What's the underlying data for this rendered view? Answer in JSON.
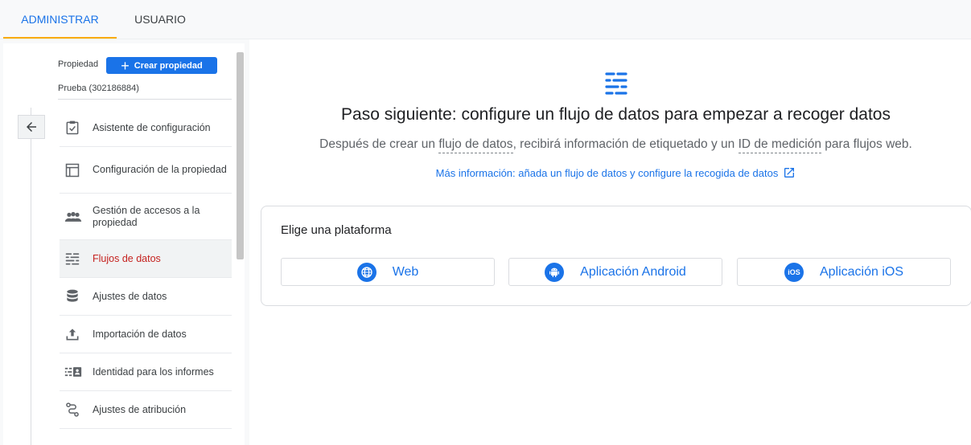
{
  "tabs": {
    "admin": "ADMINISTRAR",
    "user": "USUARIO"
  },
  "sidebar": {
    "property_label": "Propiedad",
    "create_button": "Crear propiedad",
    "property_name": "Prueba (302186884)",
    "items": [
      {
        "label": "Asistente de configuración",
        "icon": "checklist-icon"
      },
      {
        "label": "Configuración de la propiedad",
        "icon": "property-layout-icon"
      },
      {
        "label": "Gestión de accesos a la propiedad",
        "icon": "people-icon"
      },
      {
        "label": "Flujos de datos",
        "icon": "data-streams-icon",
        "active": true
      },
      {
        "label": "Ajustes de datos",
        "icon": "database-icon"
      },
      {
        "label": "Importación de datos",
        "icon": "upload-icon"
      },
      {
        "label": "Identidad para los informes",
        "icon": "identity-icon"
      },
      {
        "label": "Ajustes de atribución",
        "icon": "attribution-icon"
      }
    ]
  },
  "main": {
    "headline": "Paso siguiente: configure un flujo de datos para empezar a recoger datos",
    "sub_before": "Después de crear un ",
    "sub_term1": "flujo de datos",
    "sub_middle": ", recibirá información de etiquetado y un ",
    "sub_term2": "ID de medición",
    "sub_after": " para flujos web.",
    "more_link": "Más información: añada un flujo de datos y configure la recogida de datos",
    "platform_title": "Elige una plataforma",
    "platforms": [
      {
        "label": "Web",
        "icon": "globe-icon"
      },
      {
        "label": "Aplicación Android",
        "icon": "android-icon"
      },
      {
        "label": "Aplicación iOS",
        "icon": "ios-icon",
        "badge": "iOS"
      }
    ]
  },
  "colors": {
    "accent": "#1a73e8",
    "tab_indicator": "#f9ab00",
    "active_item": "#c5221f"
  }
}
